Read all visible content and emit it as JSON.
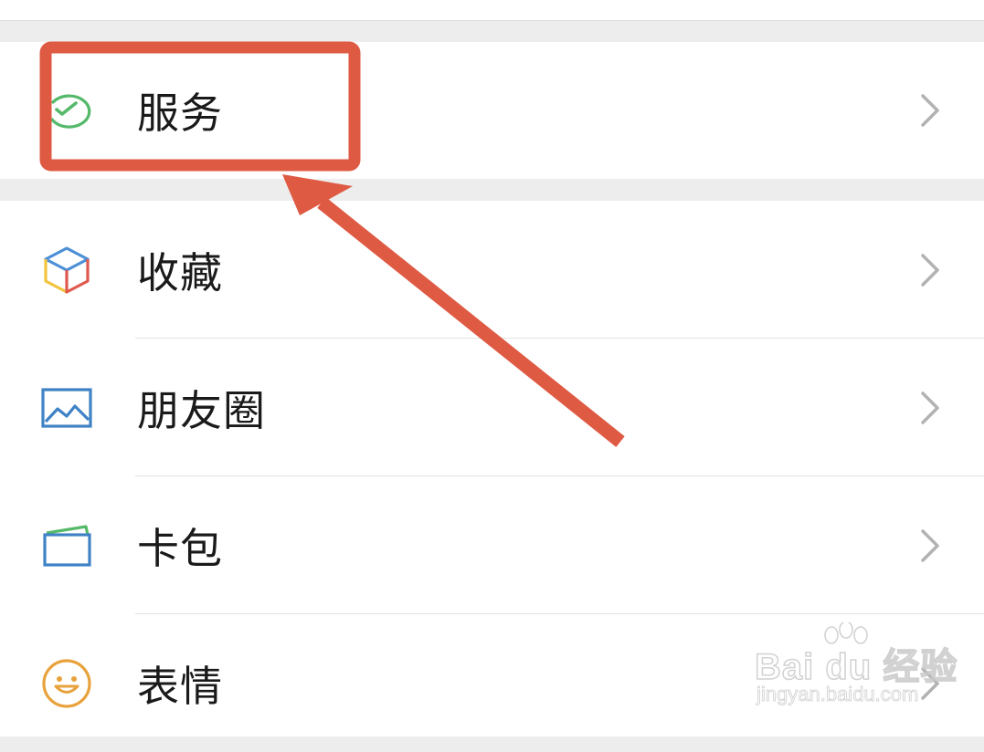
{
  "menu": {
    "service": {
      "label": "服务",
      "icon": "wechat-pay-check-icon"
    },
    "favorites": {
      "label": "收藏",
      "icon": "cube-icon"
    },
    "moments": {
      "label": "朋友圈",
      "icon": "picture-icon"
    },
    "cards": {
      "label": "卡包",
      "icon": "card-wallet-icon"
    },
    "stickers": {
      "label": "表情",
      "icon": "smiley-icon"
    }
  },
  "annotation": {
    "highlight_color": "#df5a43",
    "arrow_color": "#df5a43"
  },
  "watermark": {
    "brand": "Bai du 经验",
    "url": "jingyan.baidu.com"
  },
  "colors": {
    "background": "#ededed",
    "row_background": "#ffffff",
    "label": "#1a1a1a",
    "chevron": "#b2b2b2",
    "service_icon": "#55b96a"
  }
}
